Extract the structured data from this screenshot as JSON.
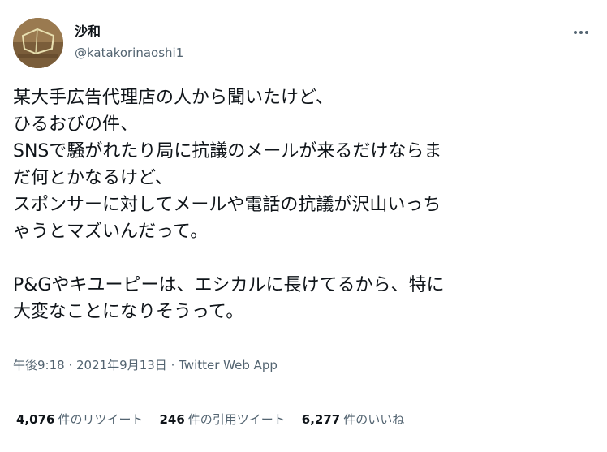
{
  "author": {
    "display_name": "沙和",
    "handle": "@katakorinaoshi1",
    "avatar_icon": "user-avatar"
  },
  "menu": {
    "icon": "more-horizontal-icon"
  },
  "tweet": {
    "lines": [
      "某大手広告代理店の人から聞いたけど、",
      "ひるおびの件、",
      "SNSで騒がれたり局に抗議のメールが来るだけならま",
      "だ何とかなるけど、",
      "スポンサーに対してメールや電話の抗議が沢山いっち",
      "ゃうとマズいんだって。",
      "",
      "P&Gやキユーピーは、エシカルに長けてるから、特に",
      "大変なことになりそうって。"
    ]
  },
  "meta": {
    "time": "午後9:18",
    "separator1": " · ",
    "date": "2021年9月13日",
    "separator2": " · ",
    "source": "Twitter Web App"
  },
  "stats": {
    "retweets_count": "4,076",
    "retweets_label": "件のリツイート",
    "quotes_count": "246",
    "quotes_label": "件の引用ツイート",
    "likes_count": "6,277",
    "likes_label": "件のいいね"
  },
  "colors": {
    "text_primary": "#0f1419",
    "text_secondary": "#536471",
    "divider": "#eff3f4"
  }
}
